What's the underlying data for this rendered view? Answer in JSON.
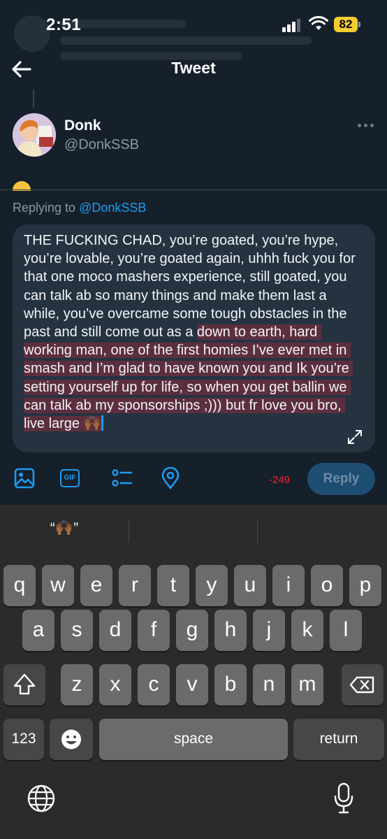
{
  "status_bar": {
    "time": "2:51",
    "battery": "82"
  },
  "header": {
    "title": "Tweet"
  },
  "tweet": {
    "name": "Donk",
    "handle": "@DonkSSB"
  },
  "reply": {
    "replying_prefix": "Replying to ",
    "replying_to": "@DonkSSB",
    "text_before_highlight": "THE FUCKING CHAD, you’re goated, you’re hype, you’re lovable, you’re goated again, uhhh fuck you for that one moco mashers experience, still goated, you can talk ab so many things and make them last a while, you’ve overcame some tough obstacles in the past and still come out as a ",
    "text_highlighted": "down to earth, hard working man, one of the first homies I’ve ever met in smash and I’m glad to have known you and Ik you’re setting yourself up for life, so when you get ballin we can talk ab my sponsorships ;))) but fr love you bro, live large 🙌🏾"
  },
  "toolbar": {
    "char_count": "-249",
    "reply_label": "Reply",
    "icons": [
      "image-icon",
      "gif-icon",
      "poll-icon",
      "location-icon"
    ],
    "gif_label": "GIF"
  },
  "keyboard": {
    "suggestion": "“🙌🏾”",
    "row1": [
      "q",
      "w",
      "e",
      "r",
      "t",
      "y",
      "u",
      "i",
      "o",
      "p"
    ],
    "row2": [
      "a",
      "s",
      "d",
      "f",
      "g",
      "h",
      "j",
      "k",
      "l"
    ],
    "row3": [
      "z",
      "x",
      "c",
      "v",
      "b",
      "n",
      "m"
    ],
    "numbers_label": "123",
    "space_label": "space",
    "return_label": "return"
  },
  "colors": {
    "background": "#15202b",
    "accent": "#1d9bf0",
    "highlight": "#5c2f3f",
    "negative_count": "#f4212e"
  }
}
